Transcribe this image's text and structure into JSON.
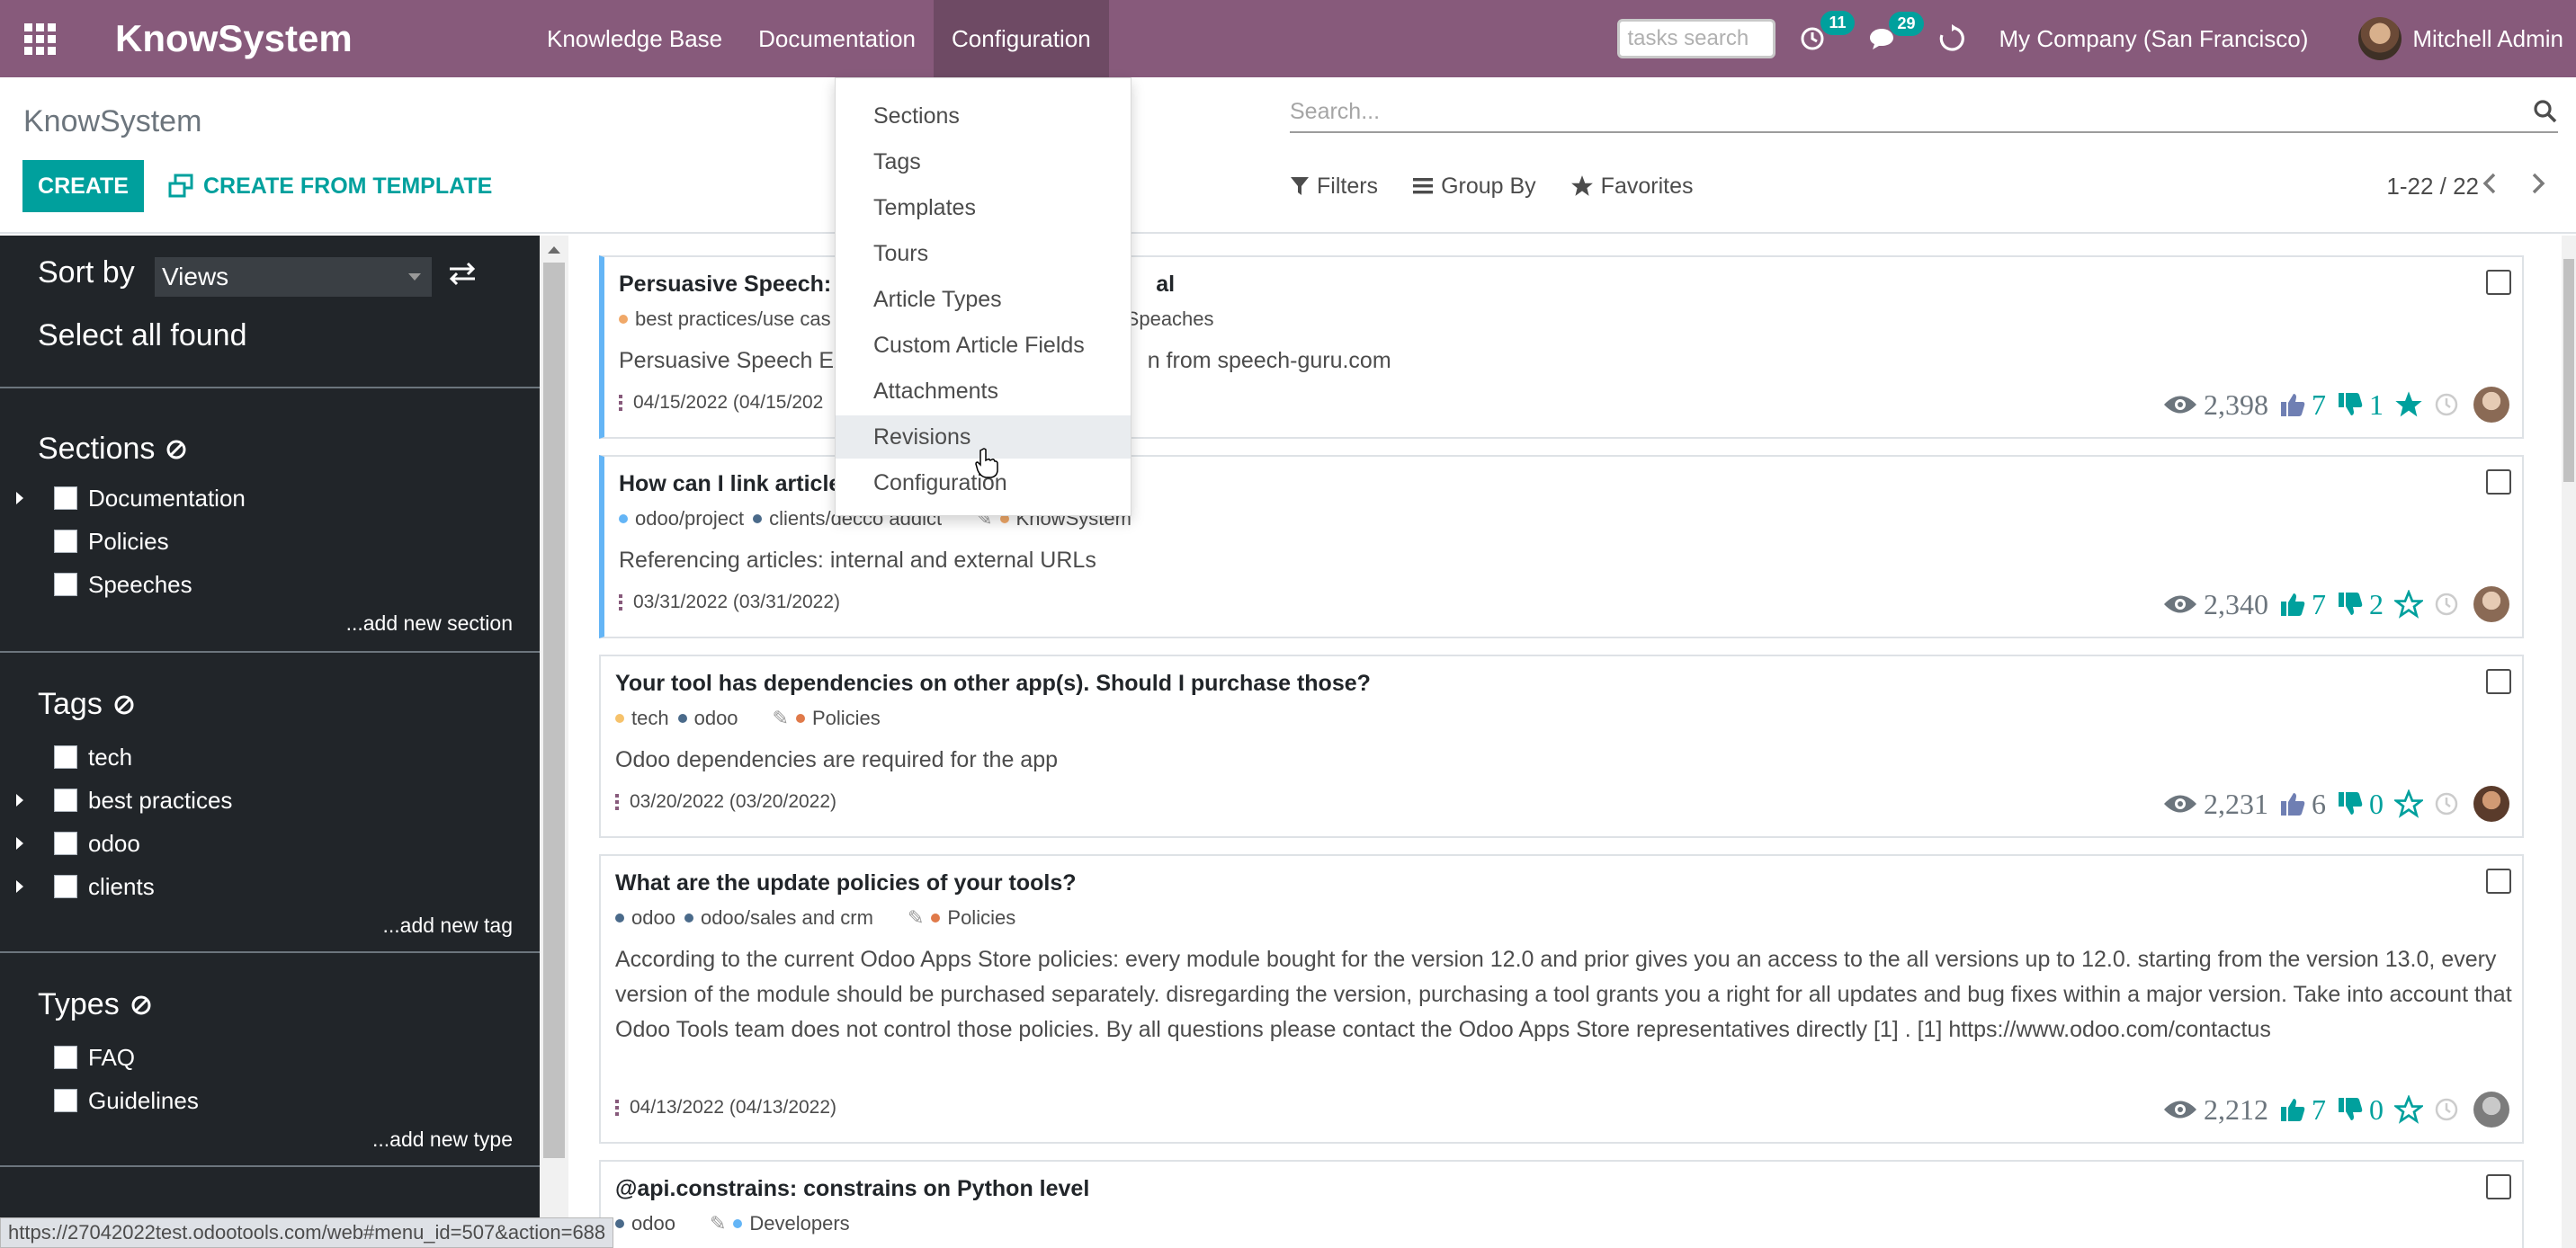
{
  "navbar": {
    "brand": "KnowSystem",
    "menu": [
      "Knowledge Base",
      "Documentation",
      "Configuration"
    ],
    "tasks_search_placeholder": "tasks search",
    "activity_count": "11",
    "messages_count": "29",
    "company": "My Company (San Francisco)",
    "user": "Mitchell Admin",
    "colors": {
      "primary": "#875a7b",
      "accent": "#00a09d"
    }
  },
  "control_panel": {
    "title": "KnowSystem",
    "create_label": "CREATE",
    "create_template_label": "CREATE FROM TEMPLATE",
    "search_placeholder": "Search...",
    "filters_label": "Filters",
    "groupby_label": "Group By",
    "favorites_label": "Favorites",
    "pager": "1-22 / 22"
  },
  "sidebar": {
    "sort_label": "Sort by",
    "sort_value": "Views",
    "select_all": "Select all found",
    "sections": {
      "title": "Sections",
      "items": [
        "Documentation",
        "Policies",
        "Speeches"
      ],
      "add_new": "...add new section"
    },
    "tags": {
      "title": "Tags",
      "items": [
        "tech",
        "best practices",
        "odoo",
        "clients"
      ],
      "add_new": "...add new tag"
    },
    "types": {
      "title": "Types",
      "items": [
        "FAQ",
        "Guidelines"
      ],
      "add_new": "...add new type"
    }
  },
  "config_menu": {
    "items": [
      "Sections",
      "Tags",
      "Templates",
      "Tours",
      "Article Types",
      "Custom Article Fields",
      "Attachments",
      "Revisions",
      "Configuration"
    ],
    "hovered": "Revisions"
  },
  "articles": [
    {
      "title": "Persuasive Speech: C",
      "title_tail": "al",
      "tag1": "best practices/use cas",
      "section": "Speaches",
      "desc_head": "Persuasive Speech EX",
      "desc_tail": "n from speech-guru.com",
      "date": "04/15/2022 (04/15/202",
      "views": "2,398",
      "likes": "7",
      "dislikes": "1"
    },
    {
      "title": "How can I link article",
      "tag1": "odoo/project",
      "tag2": "clients/decco addict",
      "section": "KnowSystem",
      "desc": "Referencing articles: internal and external URLs",
      "date": "03/31/2022 (03/31/2022)",
      "views": "2,340",
      "likes": "7",
      "dislikes": "2"
    },
    {
      "title": "Your tool has dependencies on other app(s). Should I purchase those?",
      "tag1": "tech",
      "tag2": "odoo",
      "section": "Policies",
      "desc": "Odoo dependencies are required for the app",
      "date": "03/20/2022 (03/20/2022)",
      "views": "2,231",
      "likes": "6",
      "dislikes": "0"
    },
    {
      "title": "What are the update policies of your tools?",
      "tag1": "odoo",
      "tag2": "odoo/sales and crm",
      "section": "Policies",
      "desc": "According to the current Odoo Apps Store policies: every module bought for the version 12.0 and prior gives you an access to the all versions up to 12.0. starting from the version 13.0, every version of the module should be purchased separately. disregarding the version, purchasing a tool grants you a right for all updates and bug fixes within a major version. Take into account that Odoo Tools team does not control those policies. By all questions please contact the Odoo Apps Store representatives directly [1] . [1] https://www.odoo.com/contactus",
      "date": "04/13/2022 (04/13/2022)",
      "views": "2,212",
      "likes": "7",
      "dislikes": "0"
    },
    {
      "title": "@api.constrains: constrains on Python level",
      "tag1": "odoo",
      "section": "Developers"
    }
  ],
  "status_url": "https://27042022test.odootools.com/web#menu_id=507&action=688"
}
